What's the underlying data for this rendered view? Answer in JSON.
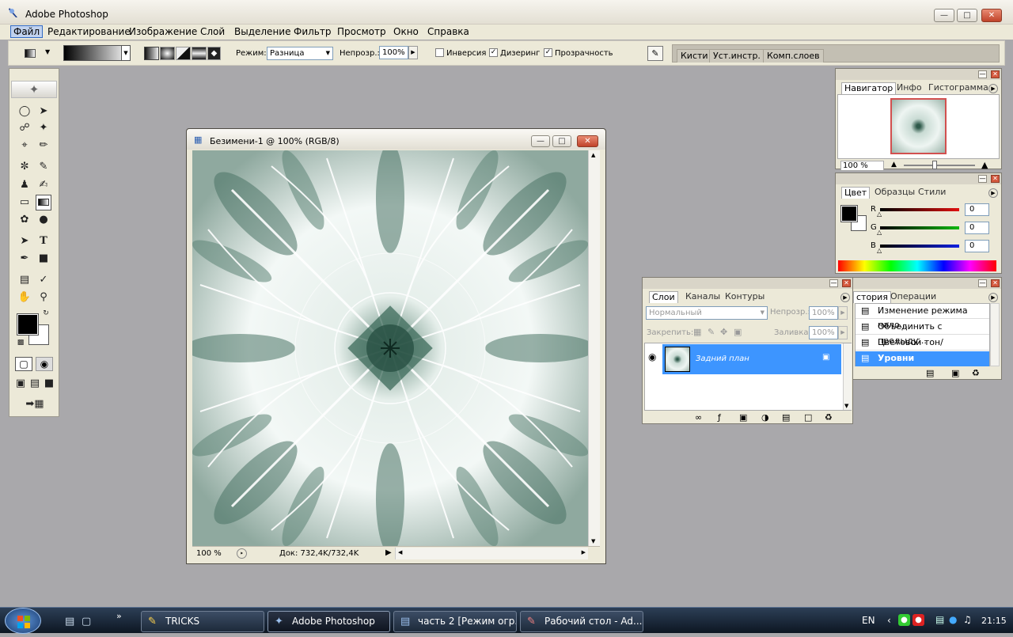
{
  "window": {
    "title": "Adobe Photoshop"
  },
  "menu": [
    "Файл",
    "Редактирование",
    "Изображение",
    "Слой",
    "Выделение",
    "Фильтр",
    "Просмотр",
    "Окно",
    "Справка"
  ],
  "options": {
    "mode_label": "Режим:",
    "mode_value": "Разница",
    "opacity_label": "Непрозр.:",
    "opacity_value": "100%",
    "reverse_label": "Инверсия",
    "dither_label": "Дизеринг",
    "transparency_label": "Прозрачность",
    "reverse_checked": false,
    "dither_checked": true,
    "transparency_checked": true
  },
  "palette_well": [
    "Кисти",
    "Уст.инстр.",
    "Комп.слоев"
  ],
  "document": {
    "title": "Безимени-1 @ 100% (RGB/8)",
    "zoom": "100 %",
    "doc_info": "Док: 732,4K/732,4K"
  },
  "navigator": {
    "tabs": [
      "Навигатор",
      "Инфо",
      "Гистограмма"
    ],
    "zoom": "100 %"
  },
  "color": {
    "tabs": [
      "Цвет",
      "Образцы",
      "Стили"
    ],
    "channels": [
      {
        "name": "R",
        "value": "0",
        "color": "#e0100f"
      },
      {
        "name": "G",
        "value": "0",
        "color": "#10b810"
      },
      {
        "name": "B",
        "value": "0",
        "color": "#1020e0"
      }
    ]
  },
  "layers": {
    "tabs": [
      "Слои",
      "Каналы",
      "Контуры"
    ],
    "blend_mode": "Нормальный",
    "opacity_label": "Непрозр.:",
    "opacity_value": "100%",
    "lock_label": "Закрепить:",
    "fill_label": "Заливка:",
    "fill_value": "100%",
    "layer_name": "Задний план"
  },
  "history": {
    "tabs": [
      "стория",
      "Операции"
    ],
    "items": [
      "Изменение режима нало...",
      "Объединить с предыду...",
      "Цветовой тон/Насыщен...",
      "Уровни"
    ],
    "selected_index": 3
  },
  "taskbar": {
    "items": [
      "TRICKS",
      "Adobe Photoshop",
      "часть 2 [Режим огр...",
      "Рабочий стол - Ad..."
    ],
    "active_index": 1,
    "lang": "EN",
    "clock": "21:15"
  }
}
